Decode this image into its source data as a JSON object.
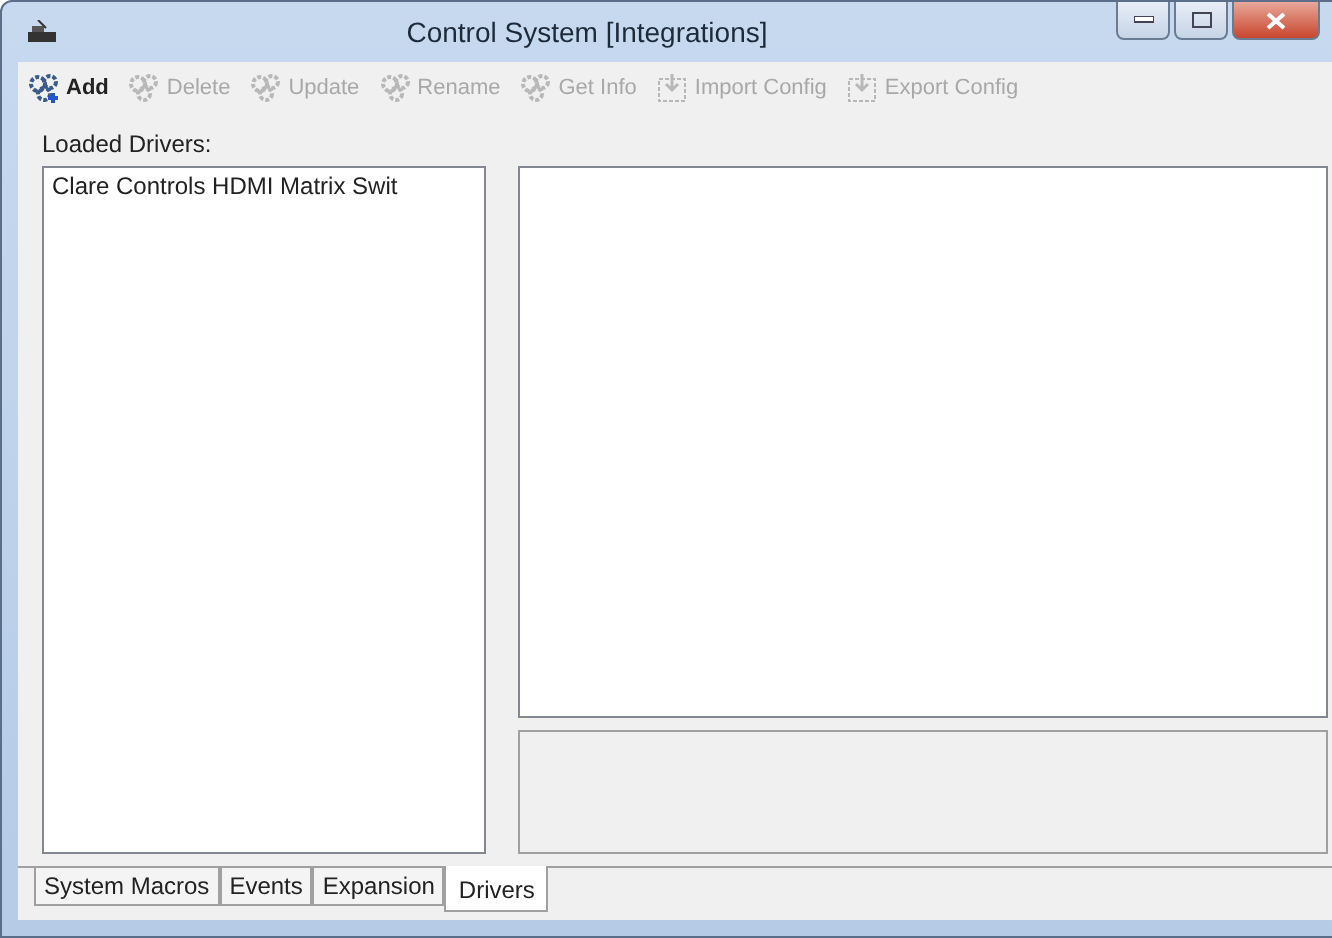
{
  "window": {
    "title": "Control System [Integrations]"
  },
  "toolbar": [
    {
      "label": "Add",
      "disabled": false,
      "kind": "gears"
    },
    {
      "label": "Delete",
      "disabled": true,
      "kind": "gears"
    },
    {
      "label": "Update",
      "disabled": true,
      "kind": "gears"
    },
    {
      "label": "Rename",
      "disabled": true,
      "kind": "gears"
    },
    {
      "label": "Get Info",
      "disabled": true,
      "kind": "gears"
    },
    {
      "label": "Import Config",
      "disabled": true,
      "kind": "document"
    },
    {
      "label": "Export Config",
      "disabled": true,
      "kind": "document"
    }
  ],
  "drivers": {
    "label": "Loaded Drivers:",
    "items": [
      {
        "label": "Clare Controls HDMI Matrix Swit",
        "selected": false
      }
    ]
  },
  "tabs": [
    {
      "label": "System Macros",
      "selected": false
    },
    {
      "label": "Events",
      "selected": false
    },
    {
      "label": "Expansion",
      "selected": false
    },
    {
      "label": "Drivers",
      "selected": true
    }
  ]
}
